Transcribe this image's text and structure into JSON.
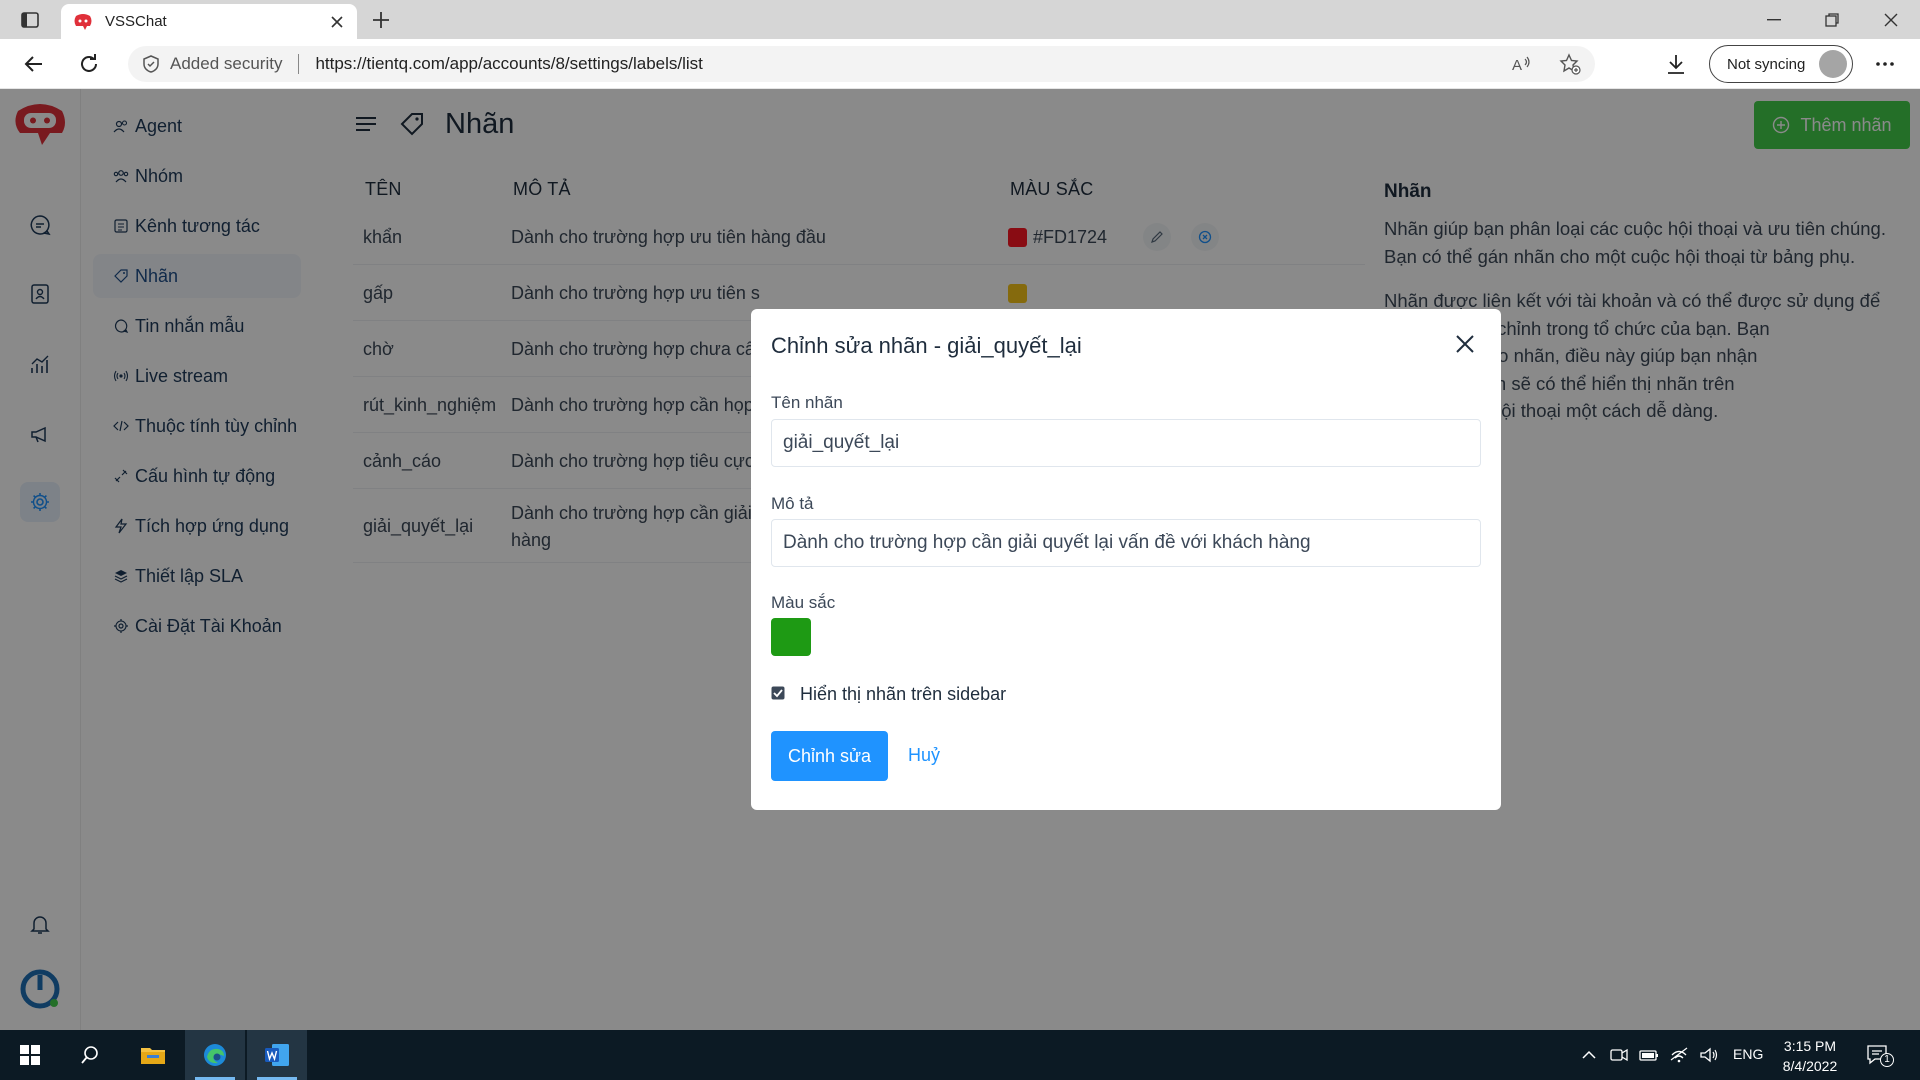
{
  "browser": {
    "tab_title": "VSSChat",
    "security_text": "Added security",
    "url": "https://tientq.com/app/accounts/8/settings/labels/list",
    "sync_label": "Not syncing"
  },
  "subnav": {
    "items": [
      {
        "label": "Agent",
        "icon": "agents-icon"
      },
      {
        "label": "Nhóm",
        "icon": "teams-icon"
      },
      {
        "label": "Kênh tương tác",
        "icon": "inbox-icon"
      },
      {
        "label": "Nhãn",
        "icon": "tag-icon",
        "active": true
      },
      {
        "label": "Tin nhắn mẫu",
        "icon": "chat-template-icon"
      },
      {
        "label": "Live stream",
        "icon": "live-icon"
      },
      {
        "label": "Thuộc tính tùy chỉnh",
        "icon": "code-icon"
      },
      {
        "label": "Cấu hình tự động",
        "icon": "automation-icon"
      },
      {
        "label": "Tích hợp ứng dụng",
        "icon": "flash-icon"
      },
      {
        "label": "Thiết lập SLA",
        "icon": "sla-icon"
      },
      {
        "label": "Cài Đặt Tài Khoản",
        "icon": "settings-icon"
      }
    ]
  },
  "main": {
    "title": "Nhãn",
    "add_button": "Thêm nhãn",
    "columns": {
      "name": "TÊN",
      "description": "MÔ TẢ",
      "color": "MÀU SẮC"
    },
    "rows": [
      {
        "name": "khẩn",
        "description": "Dành cho trường hợp ưu tiên hàng đầu",
        "color": "#FD1724",
        "color_label": "#FD1724"
      },
      {
        "name": "gấp",
        "description": "Dành cho trường hợp ưu tiên s",
        "color": "#F5C518",
        "color_label": ""
      },
      {
        "name": "chờ",
        "description": "Dành cho trường hợp chưa cấp",
        "color": "",
        "color_label": ""
      },
      {
        "name": "rút_kinh_nghiệm",
        "description": "Dành cho trường hợp cần họp",
        "color": "",
        "color_label": ""
      },
      {
        "name": "cảnh_cáo",
        "description": "Dành cho trường hợp tiêu cực (",
        "color": "",
        "color_label": ""
      },
      {
        "name": "giải_quyết_lại",
        "description": "Dành cho trường hợp cần giải c",
        "description_line2": "hàng",
        "color": "",
        "color_label": ""
      }
    ]
  },
  "info": {
    "title": "Nhãn",
    "para1": "Nhãn giúp bạn phân loại các cuộc hội thoại và ưu tiên chúng. Bạn có thể gán nhãn cho một cuộc hội thoại từ bảng phụ.",
    "para2_lines": [
      "Nhãn được liên kết với tài khoản và có thể được sử dụng để",
      "công việc tùy chỉnh trong tổ chức của bạn. Bạn",
      "u tùy chỉnh cho nhãn, điều này giúp bạn nhận",
      "dàng hơn. Bạn sẽ có thể hiển thị nhãn trên",
      "lọc các cuộc hội thoại một cách dễ dàng."
    ]
  },
  "modal": {
    "title": "Chỉnh sửa nhãn - giải_quyết_lại",
    "name_label": "Tên nhãn",
    "name_value": "giải_quyết_lại",
    "desc_label": "Mô tả",
    "desc_value": "Dành cho trường hợp cần giải quyết lại vấn đề với khách hàng",
    "color_label": "Màu sắc",
    "color_value": "#1e9a14",
    "checkbox_label": "Hiển thị nhãn trên sidebar",
    "checkbox_checked": true,
    "submit_label": "Chỉnh sửa",
    "cancel_label": "Huỷ"
  },
  "taskbar": {
    "language": "ENG",
    "time": "3:15 PM",
    "date": "8/4/2022",
    "notification_count": "1"
  },
  "colors": {
    "brand_red": "#e0303a",
    "accent_blue": "#1f93ff",
    "add_green": "#44ce4b"
  }
}
